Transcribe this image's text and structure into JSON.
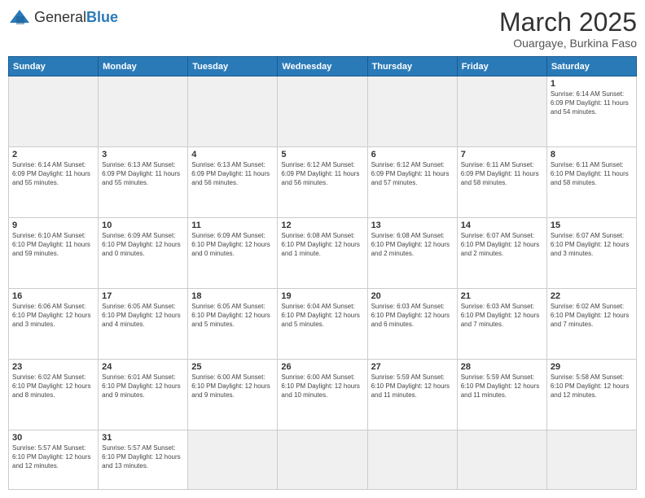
{
  "logo": {
    "text_general": "General",
    "text_blue": "Blue"
  },
  "header": {
    "month": "March 2025",
    "location": "Ouargaye, Burkina Faso"
  },
  "days_of_week": [
    "Sunday",
    "Monday",
    "Tuesday",
    "Wednesday",
    "Thursday",
    "Friday",
    "Saturday"
  ],
  "weeks": [
    [
      null,
      null,
      null,
      null,
      null,
      null,
      {
        "day": "1",
        "info": "Sunrise: 6:14 AM\nSunset: 6:09 PM\nDaylight: 11 hours\nand 54 minutes."
      }
    ],
    [
      {
        "day": "2",
        "info": "Sunrise: 6:14 AM\nSunset: 6:09 PM\nDaylight: 11 hours\nand 55 minutes."
      },
      {
        "day": "3",
        "info": "Sunrise: 6:13 AM\nSunset: 6:09 PM\nDaylight: 11 hours\nand 55 minutes."
      },
      {
        "day": "4",
        "info": "Sunrise: 6:13 AM\nSunset: 6:09 PM\nDaylight: 11 hours\nand 56 minutes."
      },
      {
        "day": "5",
        "info": "Sunrise: 6:12 AM\nSunset: 6:09 PM\nDaylight: 11 hours\nand 56 minutes."
      },
      {
        "day": "6",
        "info": "Sunrise: 6:12 AM\nSunset: 6:09 PM\nDaylight: 11 hours\nand 57 minutes."
      },
      {
        "day": "7",
        "info": "Sunrise: 6:11 AM\nSunset: 6:09 PM\nDaylight: 11 hours\nand 58 minutes."
      },
      {
        "day": "8",
        "info": "Sunrise: 6:11 AM\nSunset: 6:10 PM\nDaylight: 11 hours\nand 58 minutes."
      }
    ],
    [
      {
        "day": "9",
        "info": "Sunrise: 6:10 AM\nSunset: 6:10 PM\nDaylight: 11 hours\nand 59 minutes."
      },
      {
        "day": "10",
        "info": "Sunrise: 6:09 AM\nSunset: 6:10 PM\nDaylight: 12 hours\nand 0 minutes."
      },
      {
        "day": "11",
        "info": "Sunrise: 6:09 AM\nSunset: 6:10 PM\nDaylight: 12 hours\nand 0 minutes."
      },
      {
        "day": "12",
        "info": "Sunrise: 6:08 AM\nSunset: 6:10 PM\nDaylight: 12 hours\nand 1 minute."
      },
      {
        "day": "13",
        "info": "Sunrise: 6:08 AM\nSunset: 6:10 PM\nDaylight: 12 hours\nand 2 minutes."
      },
      {
        "day": "14",
        "info": "Sunrise: 6:07 AM\nSunset: 6:10 PM\nDaylight: 12 hours\nand 2 minutes."
      },
      {
        "day": "15",
        "info": "Sunrise: 6:07 AM\nSunset: 6:10 PM\nDaylight: 12 hours\nand 3 minutes."
      }
    ],
    [
      {
        "day": "16",
        "info": "Sunrise: 6:06 AM\nSunset: 6:10 PM\nDaylight: 12 hours\nand 3 minutes."
      },
      {
        "day": "17",
        "info": "Sunrise: 6:05 AM\nSunset: 6:10 PM\nDaylight: 12 hours\nand 4 minutes."
      },
      {
        "day": "18",
        "info": "Sunrise: 6:05 AM\nSunset: 6:10 PM\nDaylight: 12 hours\nand 5 minutes."
      },
      {
        "day": "19",
        "info": "Sunrise: 6:04 AM\nSunset: 6:10 PM\nDaylight: 12 hours\nand 5 minutes."
      },
      {
        "day": "20",
        "info": "Sunrise: 6:03 AM\nSunset: 6:10 PM\nDaylight: 12 hours\nand 6 minutes."
      },
      {
        "day": "21",
        "info": "Sunrise: 6:03 AM\nSunset: 6:10 PM\nDaylight: 12 hours\nand 7 minutes."
      },
      {
        "day": "22",
        "info": "Sunrise: 6:02 AM\nSunset: 6:10 PM\nDaylight: 12 hours\nand 7 minutes."
      }
    ],
    [
      {
        "day": "23",
        "info": "Sunrise: 6:02 AM\nSunset: 6:10 PM\nDaylight: 12 hours\nand 8 minutes."
      },
      {
        "day": "24",
        "info": "Sunrise: 6:01 AM\nSunset: 6:10 PM\nDaylight: 12 hours\nand 9 minutes."
      },
      {
        "day": "25",
        "info": "Sunrise: 6:00 AM\nSunset: 6:10 PM\nDaylight: 12 hours\nand 9 minutes."
      },
      {
        "day": "26",
        "info": "Sunrise: 6:00 AM\nSunset: 6:10 PM\nDaylight: 12 hours\nand 10 minutes."
      },
      {
        "day": "27",
        "info": "Sunrise: 5:59 AM\nSunset: 6:10 PM\nDaylight: 12 hours\nand 11 minutes."
      },
      {
        "day": "28",
        "info": "Sunrise: 5:59 AM\nSunset: 6:10 PM\nDaylight: 12 hours\nand 11 minutes."
      },
      {
        "day": "29",
        "info": "Sunrise: 5:58 AM\nSunset: 6:10 PM\nDaylight: 12 hours\nand 12 minutes."
      }
    ],
    [
      {
        "day": "30",
        "info": "Sunrise: 5:57 AM\nSunset: 6:10 PM\nDaylight: 12 hours\nand 12 minutes."
      },
      {
        "day": "31",
        "info": "Sunrise: 5:57 AM\nSunset: 6:10 PM\nDaylight: 12 hours\nand 13 minutes."
      },
      null,
      null,
      null,
      null,
      null
    ]
  ]
}
